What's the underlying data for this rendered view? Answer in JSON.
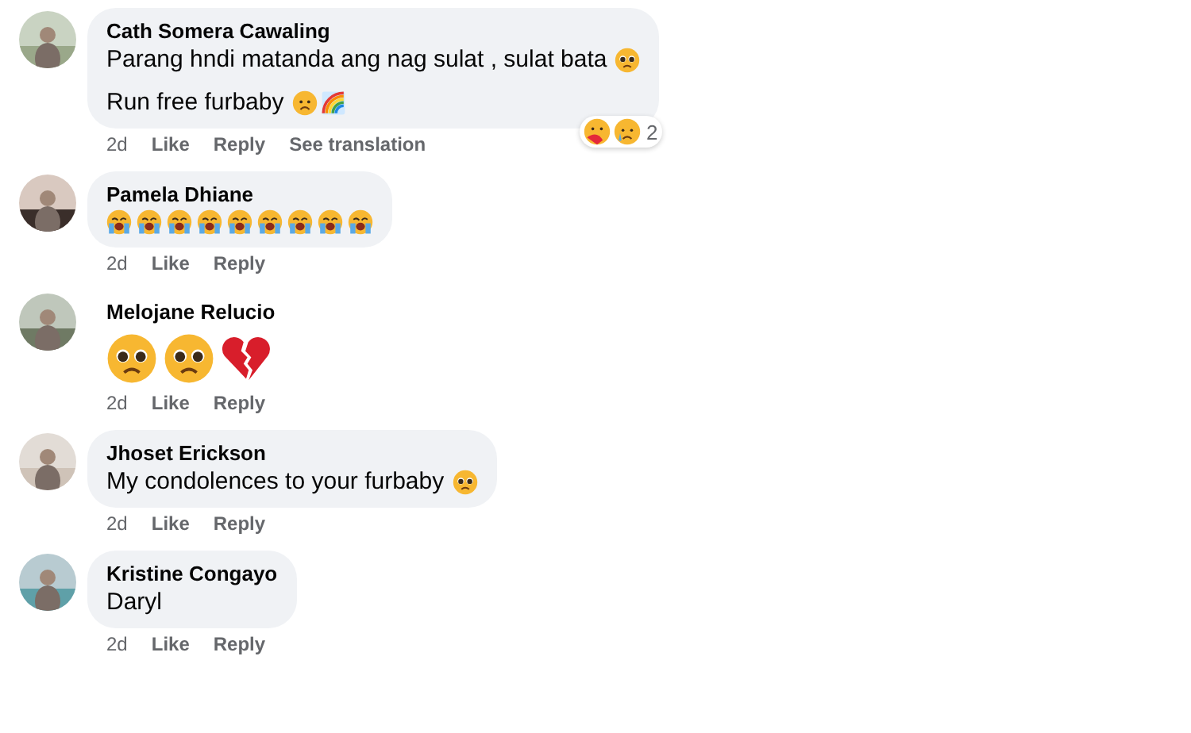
{
  "comments": [
    {
      "kind": "bubble",
      "author": "Cath Somera Cawaling",
      "lines": [
        [
          {
            "kind": "text",
            "text": "Parang hndi matanda ang nag sulat , sulat bata"
          },
          {
            "kind": "pleading"
          }
        ],
        [
          {
            "kind": "text",
            "text": "Run free furbaby"
          },
          {
            "kind": "frown"
          },
          {
            "kind": "rainbow"
          }
        ]
      ],
      "time": "2d",
      "actions": [
        "Like",
        "Reply",
        "See translation"
      ],
      "reactions": {
        "count": "2"
      }
    },
    {
      "kind": "bubble",
      "author": "Pamela Dhiane",
      "lines": [
        [
          {
            "kind": "crying"
          },
          {
            "kind": "crying"
          },
          {
            "kind": "crying"
          },
          {
            "kind": "crying"
          },
          {
            "kind": "crying"
          },
          {
            "kind": "crying"
          },
          {
            "kind": "crying"
          },
          {
            "kind": "crying"
          },
          {
            "kind": "crying"
          }
        ]
      ],
      "time": "2d",
      "actions": [
        "Like",
        "Reply"
      ]
    },
    {
      "kind": "jumbo",
      "author": "Melojane Relucio",
      "lines": [
        [
          {
            "kind": "pleading"
          },
          {
            "kind": "pleading"
          },
          {
            "kind": "broken-heart"
          }
        ]
      ],
      "time": "2d",
      "actions": [
        "Like",
        "Reply"
      ]
    },
    {
      "kind": "bubble",
      "author": "Jhoset Erickson",
      "lines": [
        [
          {
            "kind": "text",
            "text": "My condolences to your furbaby"
          },
          {
            "kind": "pleading"
          }
        ]
      ],
      "time": "2d",
      "actions": [
        "Like",
        "Reply"
      ]
    },
    {
      "kind": "bubble",
      "author": "Kristine Congayo",
      "lines": [
        [
          {
            "kind": "text",
            "text": "Daryl"
          }
        ]
      ],
      "time": "2d",
      "actions": [
        "Like",
        "Reply"
      ]
    }
  ]
}
